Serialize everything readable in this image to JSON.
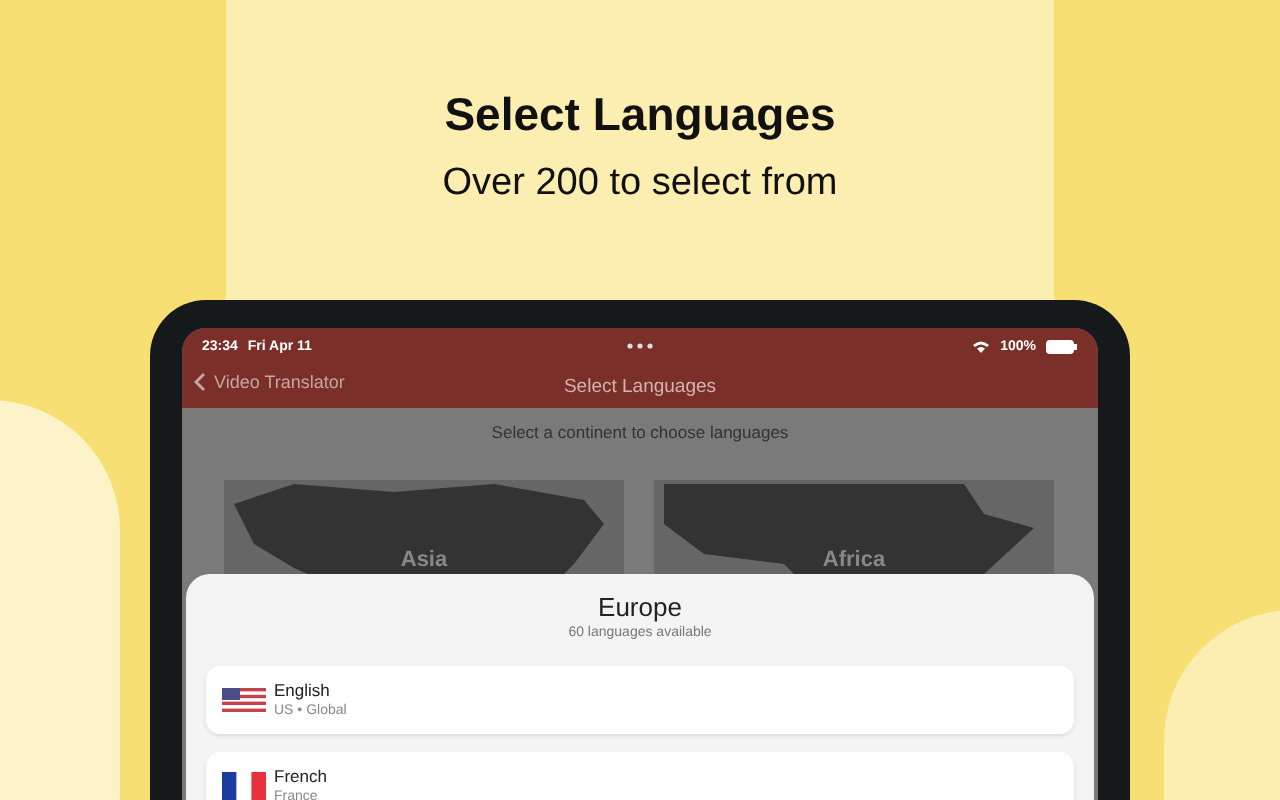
{
  "headline": {
    "title": "Select Languages",
    "subtitle": "Over 200 to select from"
  },
  "status_bar": {
    "time": "23:34",
    "date": "Fri Apr 11",
    "battery": "100%"
  },
  "nav_bar": {
    "back": "Video Translator",
    "title": "Select Languages"
  },
  "prompt": "Select a continent to choose languages",
  "continents": [
    {
      "name": "Asia",
      "kind": "asia"
    },
    {
      "name": "Africa",
      "kind": "africa"
    }
  ],
  "sheet": {
    "title": "Europe",
    "subtitle": "60 languages available",
    "languages": [
      {
        "name": "English",
        "region": "US • Global",
        "kind": "us"
      },
      {
        "name": "French",
        "region": "France",
        "kind": "fr"
      }
    ]
  }
}
